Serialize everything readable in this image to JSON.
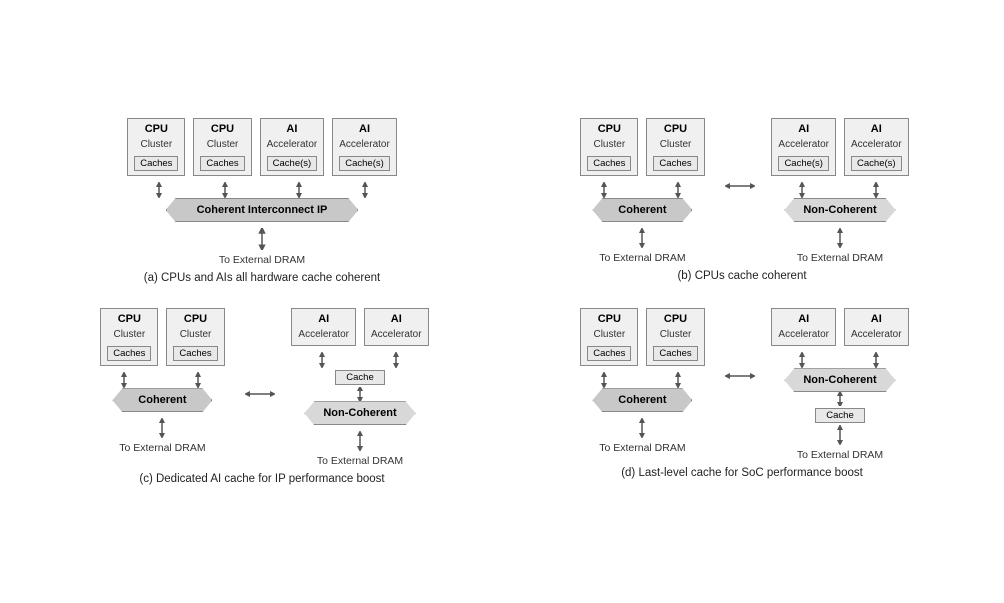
{
  "diagrams": {
    "a": {
      "caption": "(a) CPUs and AIs all hardware cache coherent",
      "procs": [
        {
          "title": "CPU",
          "sub": "Cluster",
          "cache": "Caches"
        },
        {
          "title": "CPU",
          "sub": "Cluster",
          "cache": "Caches"
        },
        {
          "title": "AI",
          "sub": "Accelerator",
          "cache": "Cache(s)"
        },
        {
          "title": "AI",
          "sub": "Accelerator",
          "cache": "Cache(s)"
        }
      ],
      "interconnect": "Coherent Interconnect IP",
      "ext_dram": "To External DRAM"
    },
    "b": {
      "caption": "(b) CPUs cache coherent",
      "left_procs": [
        {
          "title": "CPU",
          "sub": "Cluster",
          "cache": "Caches"
        },
        {
          "title": "CPU",
          "sub": "Cluster",
          "cache": "Caches"
        }
      ],
      "right_procs": [
        {
          "title": "AI",
          "sub": "Accelerator",
          "cache": "Cache(s)"
        },
        {
          "title": "AI",
          "sub": "Accelerator",
          "cache": "Cache(s)"
        }
      ],
      "left_banner": "Coherent",
      "right_banner": "Non-Coherent",
      "left_dram": "To External DRAM",
      "right_dram": "To External DRAM"
    },
    "c": {
      "caption": "(c) Dedicated AI cache for IP performance boost",
      "left_procs": [
        {
          "title": "CPU",
          "sub": "Cluster",
          "cache": "Caches"
        },
        {
          "title": "CPU",
          "sub": "Cluster",
          "cache": "Caches"
        }
      ],
      "right_procs": [
        {
          "title": "AI",
          "sub": "Accelerator",
          "cache": ""
        },
        {
          "title": "AI",
          "sub": "Accelerator",
          "cache": ""
        }
      ],
      "mid_cache": "Cache",
      "left_banner": "Coherent",
      "right_banner": "Non-Coherent",
      "left_dram": "To External DRAM",
      "right_dram": "To External DRAM"
    },
    "d": {
      "caption": "(d) Last-level cache for SoC performance boost",
      "left_procs": [
        {
          "title": "CPU",
          "sub": "Cluster",
          "cache": "Caches"
        },
        {
          "title": "CPU",
          "sub": "Cluster",
          "cache": "Caches"
        }
      ],
      "right_procs": [
        {
          "title": "AI",
          "sub": "Accelerator",
          "cache": ""
        },
        {
          "title": "AI",
          "sub": "Accelerator",
          "cache": ""
        }
      ],
      "mid_cache": "Cache",
      "left_banner": "Coherent",
      "right_banner": "Non-Coherent",
      "left_dram": "To External DRAM",
      "right_dram": "To External DRAM"
    }
  }
}
